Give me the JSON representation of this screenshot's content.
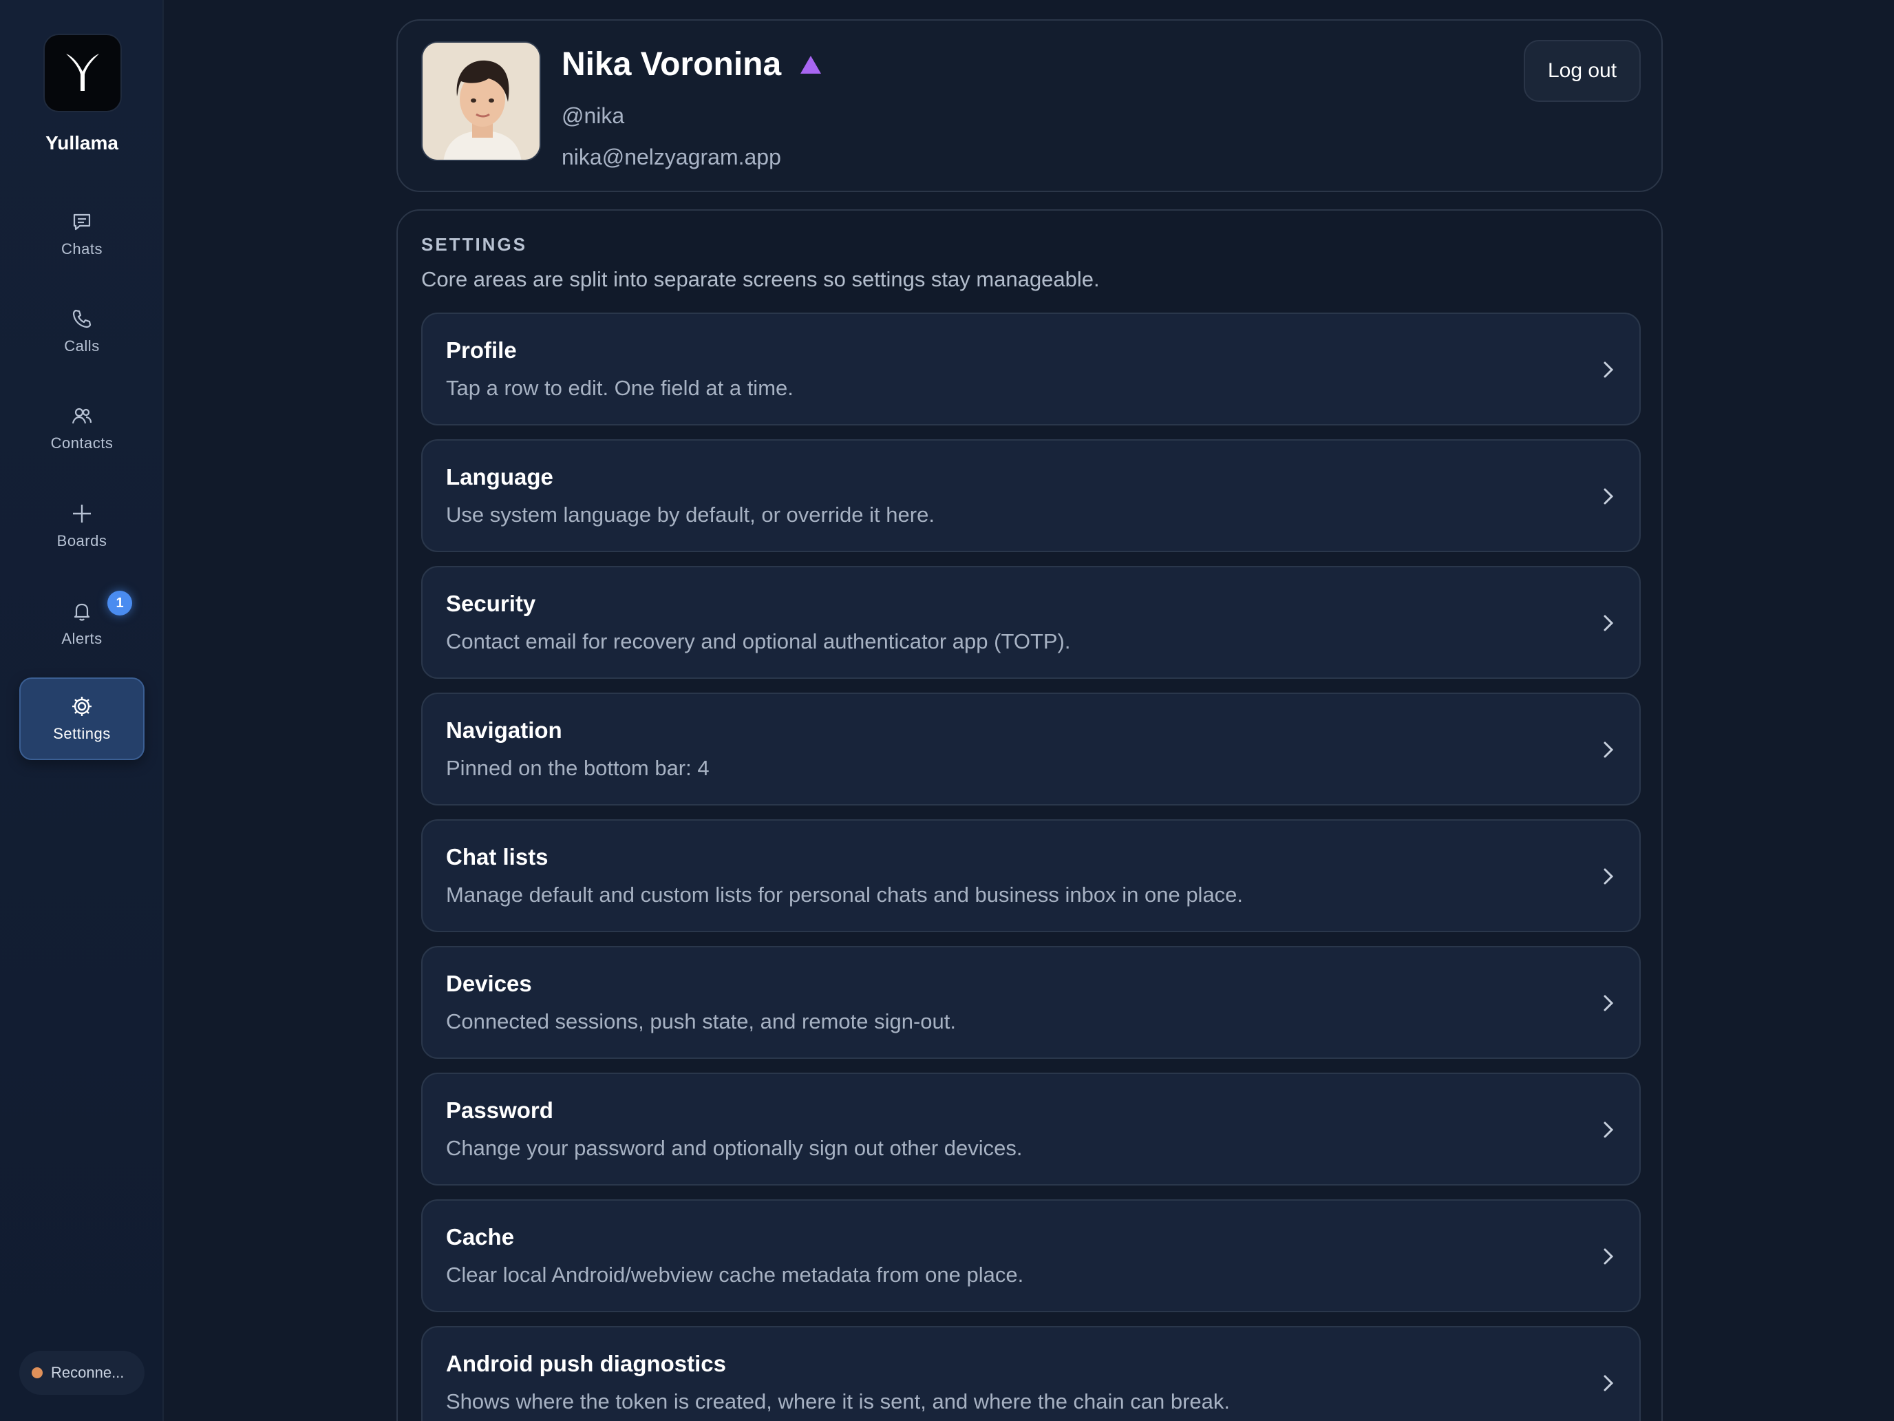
{
  "app": {
    "name": "Yullama",
    "logo_icon": "y-logo-icon"
  },
  "sidebar": {
    "items": [
      {
        "label": "Chats",
        "icon": "chat-bubble-icon"
      },
      {
        "label": "Calls",
        "icon": "phone-icon"
      },
      {
        "label": "Contacts",
        "icon": "contacts-icon"
      },
      {
        "label": "Boards",
        "icon": "plus-icon"
      },
      {
        "label": "Alerts",
        "icon": "bell-icon",
        "badge": "1"
      },
      {
        "label": "Settings",
        "icon": "gear-icon",
        "active": true
      }
    ],
    "connection_status": "Reconne...",
    "connection_status_color": "#e0915a"
  },
  "profile": {
    "name": "Nika Voronina",
    "premium_icon": "purple-triangle-icon",
    "premium_color": "#a866f2",
    "handle": "@nika",
    "email": "nika@nelzyagram.app",
    "logout_label": "Log out"
  },
  "settings": {
    "section_title": "SETTINGS",
    "section_description": "Core areas are split into separate screens so settings stay manageable.",
    "rows": [
      {
        "title": "Profile",
        "subtitle": "Tap a row to edit. One field at a time."
      },
      {
        "title": "Language",
        "subtitle": "Use system language by default, or override it here."
      },
      {
        "title": "Security",
        "subtitle": "Contact email for recovery and optional authenticator app (TOTP)."
      },
      {
        "title": "Navigation",
        "subtitle": "Pinned on the bottom bar: 4"
      },
      {
        "title": "Chat lists",
        "subtitle": "Manage default and custom lists for personal chats and business inbox in one place."
      },
      {
        "title": "Devices",
        "subtitle": "Connected sessions, push state, and remote sign-out."
      },
      {
        "title": "Password",
        "subtitle": "Change your password and optionally sign out other devices."
      },
      {
        "title": "Cache",
        "subtitle": "Clear local Android/webview cache metadata from one place."
      },
      {
        "title": "Android push diagnostics",
        "subtitle": "Shows where the token is created, where it is sent, and where the chain can break."
      }
    ]
  },
  "colors": {
    "background": "#111a2a",
    "accent": "#4a8cf0",
    "active_nav": "#25406a"
  }
}
